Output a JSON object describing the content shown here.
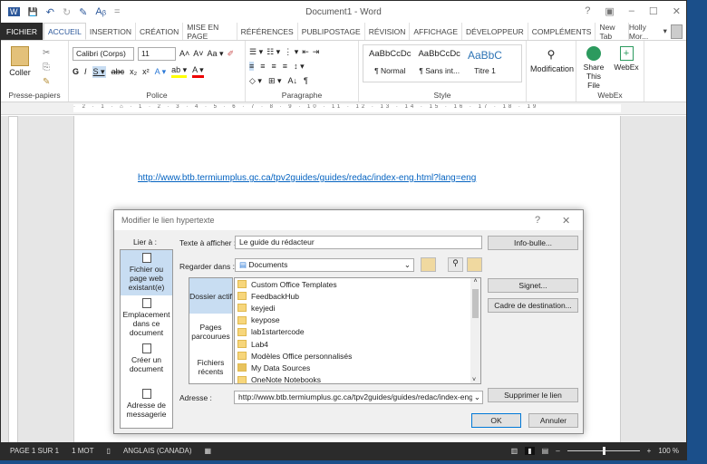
{
  "window": {
    "title": "Document1 - Word",
    "help": "?",
    "controls": [
      "▣",
      "–",
      "☐",
      "✕"
    ]
  },
  "quick_access": [
    "W",
    "💾",
    "↶",
    "↻",
    "✎",
    "Aᵦ",
    "="
  ],
  "tabs": [
    "FICHIER",
    "ACCUEIL",
    "INSERTION",
    "CRÉATION",
    "MISE EN PAGE",
    "RÉFÉRENCES",
    "PUBLIPOSTAGE",
    "RÉVISION",
    "AFFICHAGE",
    "DÉVELOPPEUR",
    "COMPLÉMENTS",
    "New Tab"
  ],
  "active_tab": "ACCUEIL",
  "user": "Holly Mor...",
  "ribbon": {
    "clipboard": {
      "paste": "Coller",
      "label": "Presse-papiers"
    },
    "font": {
      "name": "Calibri (Corps)",
      "size": "11",
      "row1": [
        "A˄",
        "A˅",
        "Aa ▾",
        "✐"
      ],
      "row2": [
        "G",
        "I",
        "S ▾",
        "abc",
        "x₂",
        "x²",
        "A ▾",
        "ab ▾",
        "A ▾"
      ],
      "label": "Police"
    },
    "paragraph": {
      "row1": [
        "☰ ▾",
        "☷ ▾",
        "⋮ ▾",
        "⇤",
        "⇥"
      ],
      "row2": [
        "≡",
        "≡",
        "≡",
        "≡",
        "↕ ▾"
      ],
      "row3": [
        "◇ ▾",
        "⊞ ▾",
        "A↓",
        "¶"
      ],
      "label": "Paragraphe"
    },
    "styles": {
      "items": [
        {
          "sample": "AaBbCcDc",
          "name": "¶ Normal"
        },
        {
          "sample": "AaBbCcDc",
          "name": "¶ Sans int..."
        },
        {
          "sample": "AaBbC",
          "name": "Titre 1"
        }
      ],
      "label": "Style"
    },
    "editing": {
      "label": "Modification"
    },
    "webex": {
      "share": "Share This File",
      "webex": "WebEx",
      "label": "WebEx"
    }
  },
  "ruler_text": "· 2 · 1 · ⌂ · 1 · 2 · 3 · 4 · 5 · 6 · 7 · 8 · 9 · 10 · 11 · 12 · 13 · 14 · 15 · 16 · 17 · 18 · 19",
  "document": {
    "link_text": "http://www.btb.termiumplus.gc.ca/tpv2guides/guides/redac/index-eng.html?lang=eng"
  },
  "dialog": {
    "title": "Modifier le lien hypertexte",
    "help": "?",
    "close": "✕",
    "link_to_label": "Lier à :",
    "link_to": [
      "Fichier ou page web existant(e)",
      "Emplacement dans ce document",
      "Créer un document",
      "Adresse de messagerie"
    ],
    "text_label": "Texte à afficher :",
    "text_value": "Le guide du rédacteur",
    "look_in_label": "Regarder dans :",
    "look_in_value": "Documents",
    "nav": [
      "Dossier actif",
      "Pages parcourues",
      "Fichiers récents"
    ],
    "files": [
      "Custom Office Templates",
      "FeedbackHub",
      "keyjedi",
      "keypose",
      "lab1startercode",
      "Lab4",
      "Modèles Office personnalisés",
      "My Data Sources",
      "OneNote Notebooks"
    ],
    "address_label": "Adresse :",
    "address_value": "http://www.btb.termiumplus.gc.ca/tpv2guides/guides/redac/index-eng.html?lang=eng",
    "buttons": {
      "tooltip": "Info-bulle...",
      "bookmark": "Signet...",
      "target": "Cadre de destination...",
      "remove": "Supprimer le lien",
      "ok": "OK",
      "cancel": "Annuler"
    }
  },
  "status": {
    "page": "PAGE 1 SUR 1",
    "words": "1 MOT",
    "language": "ANGLAIS (CANADA)",
    "zoom": "100 %",
    "zoom_percent": 100
  }
}
